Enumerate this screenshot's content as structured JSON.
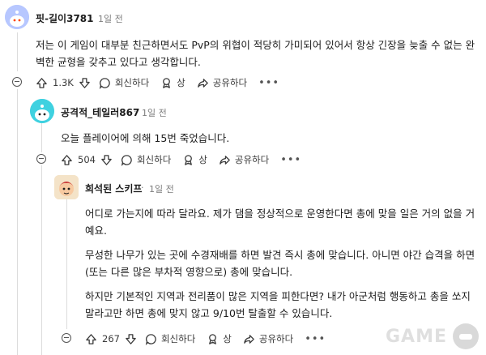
{
  "comments": [
    {
      "author": "핏-길이3781",
      "sep": "·",
      "time": "1일 전",
      "text": "저는 이 게임이 대부분 친근하면서도 PvP의 위협이 적당히 가미되어 있어서 항상 긴장을 늦출 수 없는 완벽한 균형을 갖추고 있다고 생각합니다.",
      "votes": "1.3K",
      "reply_label": "회신하다",
      "award_label": "상",
      "share_label": "공유하다",
      "more_label": "•••"
    },
    {
      "author": "공격적_테일러867",
      "sep": "·",
      "time": "1일 전",
      "text": "오늘 플레이어에 의해 15번 죽었습니다.",
      "votes": "504",
      "reply_label": "회신하다",
      "award_label": "상",
      "share_label": "공유하다",
      "more_label": "•••"
    },
    {
      "author": "희석된 스키프",
      "sep": "·",
      "time": "1일 전",
      "paragraphs": [
        "어디로 가는지에 따라 달라요. 제가 댐을 정상적으로 운영한다면 총에 맞을 일은 거의 없을 거예요.",
        "무성한 나무가 있는 곳에 수경재배를 하면 발견 즉시 총에 맞습니다. 아니면 야간 습격을 하면(또는 다른 많은 부차적 영향으로) 총에 맞습니다.",
        "하지만 기본적인 지역과 전리품이 많은 지역을 피한다면? 내가 아군처럼 행동하고 총을 쏘지 말라고만 하면 총에 맞지 않고 9/10번 탈출할 수 있습니다."
      ],
      "votes": "267",
      "reply_label": "회신하다",
      "award_label": "상",
      "share_label": "공유하다",
      "more_label": "•••"
    }
  ],
  "watermark": "GAME",
  "colors": {
    "avatar1": "#b7c7ff",
    "avatar2": "#3fd1e0",
    "avatar3": "#f4e3c8"
  }
}
